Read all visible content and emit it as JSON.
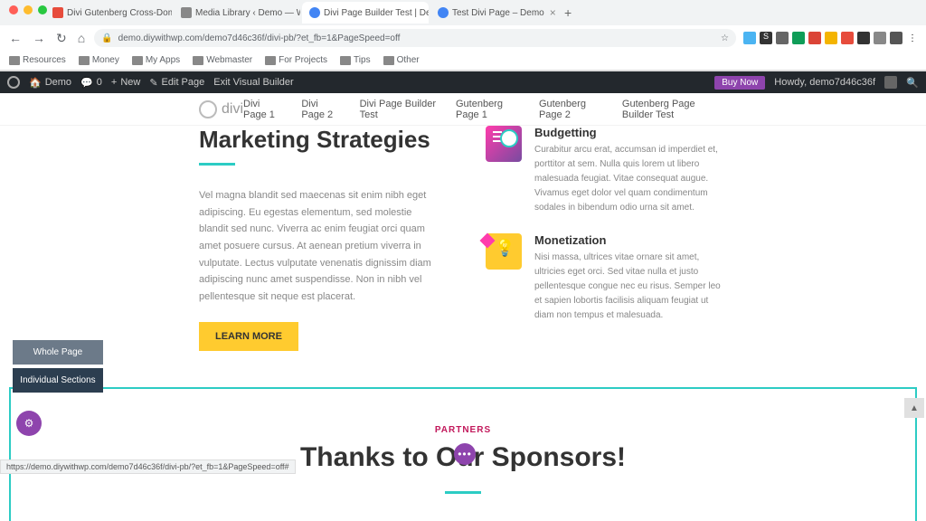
{
  "tabs": [
    {
      "label": "Divi Gutenberg Cross-Domain",
      "active": false,
      "faviconClass": "fav-red"
    },
    {
      "label": "Media Library ‹ Demo — Word",
      "active": false,
      "faviconClass": "fav-gray"
    },
    {
      "label": "Divi Page Builder Test | Demo",
      "active": true,
      "faviconClass": "fav-blue"
    },
    {
      "label": "Test Divi Page – Demo",
      "active": false,
      "faviconClass": "fav-blue"
    }
  ],
  "url": "demo.diywithwp.com/demo7d46c36f/divi-pb/?et_fb=1&PageSpeed=off",
  "bookmarks": [
    "Resources",
    "Money",
    "My Apps",
    "Webmaster",
    "For Projects",
    "Tips",
    "Other"
  ],
  "wp": {
    "site": "Demo",
    "comments": "0",
    "new": "New",
    "edit": "Edit Page",
    "exit": "Exit Visual Builder",
    "buy": "Buy Now",
    "howdy_pre": "Howdy,",
    "howdy_user": "demo7d46c36f"
  },
  "nav": {
    "logo": "divi",
    "items": [
      "Divi Page 1",
      "Divi Page 2",
      "Divi Page Builder Test",
      "Gutenberg Page 1",
      "Gutenberg Page 2",
      "Gutenberg Page Builder Test"
    ]
  },
  "hero": {
    "title": "Marketing Strategies",
    "body": "Vel magna blandit sed maecenas sit enim nibh eget adipiscing. Eu egestas elementum, sed molestie blandit sed nunc. Viverra ac enim feugiat orci quam amet posuere cursus. At aenean pretium viverra in vulputate. Lectus vulputate venenatis dignissim diam adipiscing nunc amet suspendisse. Non in nibh vel pellentesque sit neque est placerat.",
    "cta": "LEARN MORE"
  },
  "features": [
    {
      "title": "Budgetting",
      "text": "Curabitur arcu erat, accumsan id imperdiet et, porttitor at sem. Nulla quis lorem ut libero malesuada feugiat. Vitae consequat augue. Vivamus eget dolor vel quam condimentum sodales in bibendum odio urna sit amet."
    },
    {
      "title": "Monetization",
      "text": "Nisi massa, ultrices vitae ornare sit amet, ultricies eget orci. Sed vitae nulla et justo pellentesque congue nec eu risus. Semper leo et sapien lobortis facilisis aliquam feugiat ut diam non tempus et malesuada."
    }
  ],
  "partners": {
    "label": "PARTNERS",
    "title": "Thanks to Our Sponsors!"
  },
  "side": {
    "whole": "Whole Page",
    "sections": "Individual Sections"
  },
  "status": "https://demo.diywithwp.com/demo7d46c36f/divi-pb/?et_fb=1&PageSpeed=off#"
}
